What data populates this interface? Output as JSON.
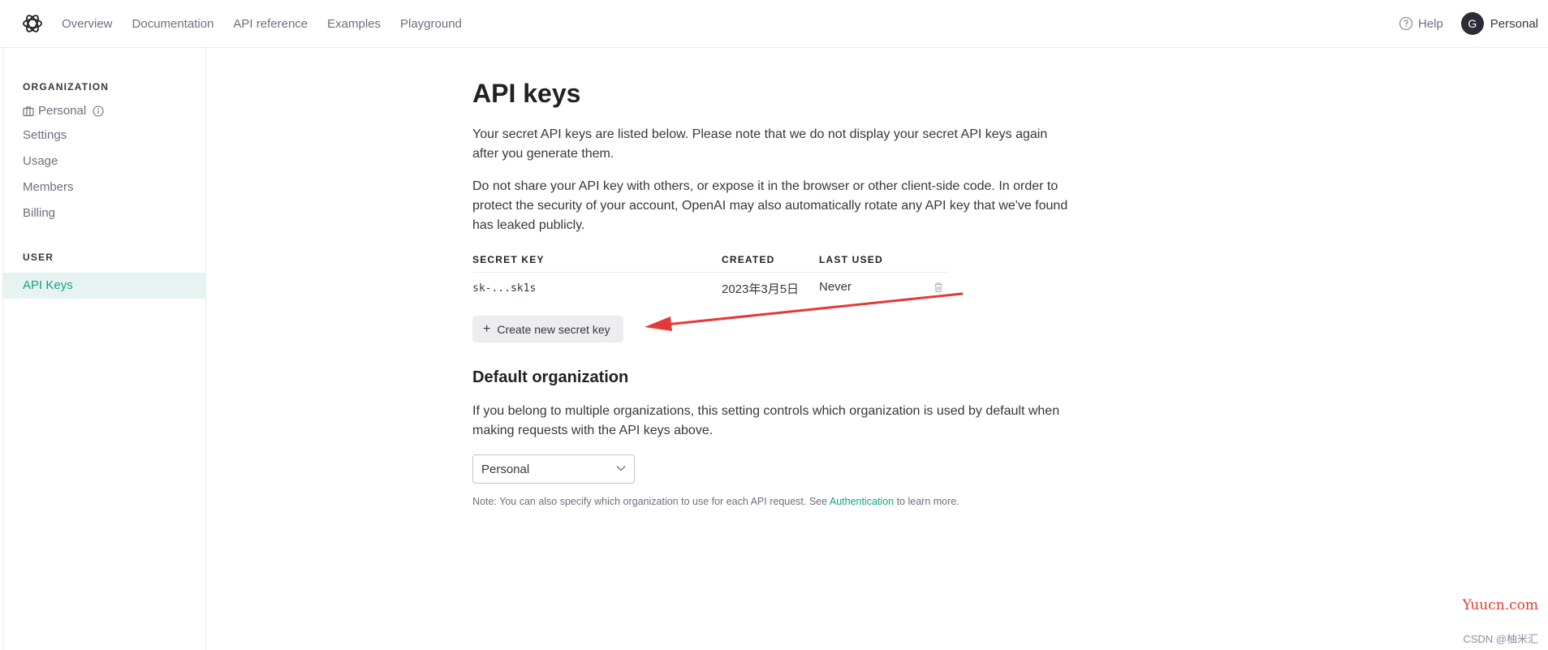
{
  "nav": {
    "links": [
      "Overview",
      "Documentation",
      "API reference",
      "Examples",
      "Playground"
    ],
    "help_label": "Help",
    "avatar_initial": "G",
    "account_name": "Personal"
  },
  "sidebar": {
    "organization_heading": "ORGANIZATION",
    "org_name": "Personal",
    "org_items": [
      "Settings",
      "Usage",
      "Members",
      "Billing"
    ],
    "user_heading": "USER",
    "user_items": [
      "API Keys"
    ]
  },
  "main": {
    "title": "API keys",
    "intro_1": "Your secret API keys are listed below. Please note that we do not display your secret API keys again after you generate them.",
    "intro_2": "Do not share your API key with others, or expose it in the browser or other client-side code. In order to protect the security of your account, OpenAI may also automatically rotate any API key that we've found has leaked publicly.",
    "table": {
      "headers": [
        "SECRET KEY",
        "CREATED",
        "LAST USED"
      ],
      "rows": [
        {
          "key": "sk-...sk1s",
          "created": "2023年3月5日",
          "last_used": "Never"
        }
      ]
    },
    "create_button": "Create new secret key",
    "default_org_title": "Default organization",
    "default_org_desc": "If you belong to multiple organizations, this setting controls which organization is used by default when making requests with the API keys above.",
    "org_select_value": "Personal",
    "note_prefix": "Note: You can also specify which organization to use for each API request. See ",
    "note_link": "Authentication",
    "note_suffix": " to learn more."
  },
  "watermarks": {
    "site": "Yuucn.com",
    "author": "CSDN @柚米汇"
  },
  "colors": {
    "accent": "#10a37f",
    "active_bg": "#e6f3f1",
    "arrow": "#e53935"
  }
}
